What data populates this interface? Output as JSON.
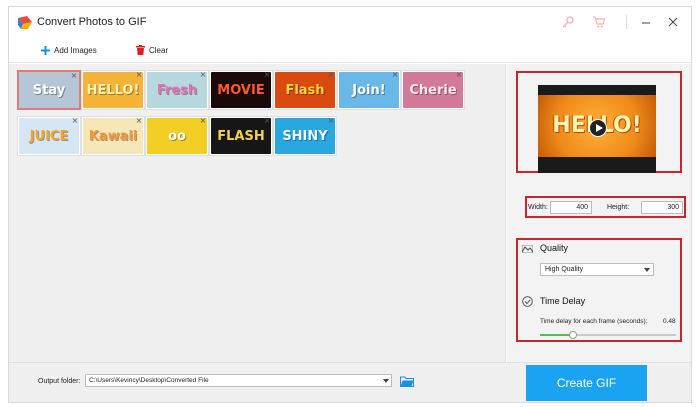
{
  "window": {
    "title": "Convert Photos to GIF",
    "icons": [
      "key-icon",
      "cart-icon",
      "minimize-icon",
      "close-icon"
    ]
  },
  "toolbar": {
    "add_images_label": "Add Images",
    "clear_label": "Clear"
  },
  "thumbnails": [
    {
      "text": "Stay",
      "selected": true,
      "bg": "#b5c7d6",
      "fg": "#ffffff"
    },
    {
      "text": "HELLO!",
      "selected": false,
      "bg": "#f5b33a",
      "fg": "#fff3b0"
    },
    {
      "text": "Fresh",
      "selected": false,
      "bg": "#b8d8e0",
      "fg": "#e96fb5"
    },
    {
      "text": "MOVIE",
      "selected": false,
      "bg": "#1a0a0a",
      "fg": "#ff5a2a"
    },
    {
      "text": "Flash",
      "selected": false,
      "bg": "#d84a10",
      "fg": "#ffd43a"
    },
    {
      "text": "Join!",
      "selected": false,
      "bg": "#6ab8e8",
      "fg": "#ffffff"
    },
    {
      "text": "Cherie",
      "selected": false,
      "bg": "#d27a99",
      "fg": "#ffe6ef"
    },
    {
      "text": "JUICE",
      "selected": false,
      "bg": "#d7e6f5",
      "fg": "#f5a623"
    },
    {
      "text": "Kawaii",
      "selected": false,
      "bg": "#f7e6b8",
      "fg": "#f29a3a"
    },
    {
      "text": "oo",
      "selected": false,
      "bg": "#f2cf25",
      "fg": "#ffffff"
    },
    {
      "text": "FLASH",
      "selected": false,
      "bg": "#161616",
      "fg": "#f5d24a"
    },
    {
      "text": "SHINY",
      "selected": false,
      "bg": "#2aa7df",
      "fg": "#e8fbff"
    }
  ],
  "preview": {
    "text": "HELLO!",
    "bg": "#f08a18"
  },
  "dimensions": {
    "width_label": "Width:",
    "width_value": "400",
    "height_label": "Height:",
    "height_value": "300"
  },
  "quality": {
    "label": "Quality",
    "selected": "High Quality"
  },
  "time_delay": {
    "label": "Time Delay",
    "description": "Time delay for each frame (seconds):",
    "value": "0.48",
    "level": 0.24
  },
  "output": {
    "label": "Output folder:",
    "path": "C:\\Users\\Kevincy\\Desktop\\Converted File"
  },
  "create_button_label": "Create GIF",
  "colors": {
    "accent": "#1aa3f0",
    "highlight_border": "#c8262b",
    "slider_fill": "#5cb85c"
  }
}
